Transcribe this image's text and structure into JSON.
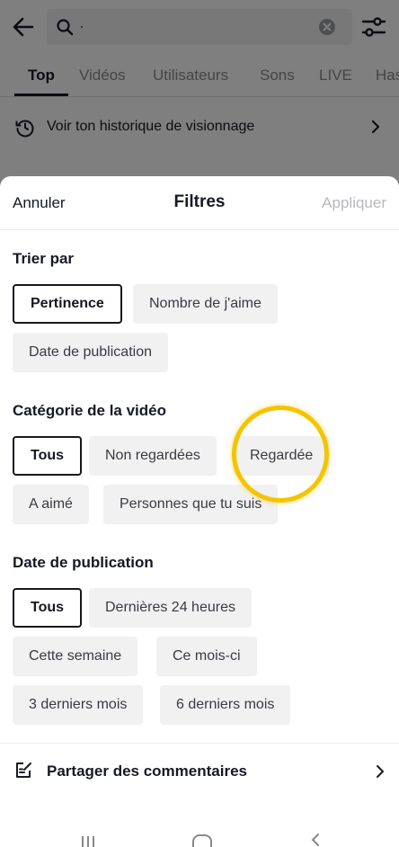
{
  "search": {
    "back_icon": "back-arrow-icon",
    "search_icon": "search-icon",
    "clear_icon": "clear-icon",
    "filter_icon": "filter-sliders-icon",
    "tabs": [
      "Top",
      "Vidéos",
      "Utilisateurs",
      "Sons",
      "LIVE",
      "Has"
    ],
    "active_tab": "Top",
    "history_label": "Voir ton historique de visionnage"
  },
  "sheet": {
    "cancel": "Annuler",
    "title": "Filtres",
    "apply": "Appliquer",
    "sort": {
      "title": "Trier par",
      "options": [
        "Pertinence",
        "Nombre de j'aime",
        "Date de publication"
      ],
      "selected": "Pertinence"
    },
    "category": {
      "title": "Catégorie de la vidéo",
      "options": [
        "Tous",
        "Non regardées",
        "Regardée",
        "A aimé",
        "Personnes que tu suis"
      ],
      "selected": "Tous"
    },
    "date": {
      "title": "Date de publication",
      "options": [
        "Tous",
        "Dernières 24 heures",
        "Cette semaine",
        "Ce mois-ci",
        "3 derniers mois",
        "6 derniers mois"
      ],
      "selected": "Tous"
    },
    "share_label": "Partager des commentaires"
  },
  "colors": {
    "text": "#161823",
    "muted": "#8a8b91",
    "chip_bg": "#f1f1f2",
    "apply_disabled": "#b8b9bd",
    "highlight": "#f5c400"
  }
}
